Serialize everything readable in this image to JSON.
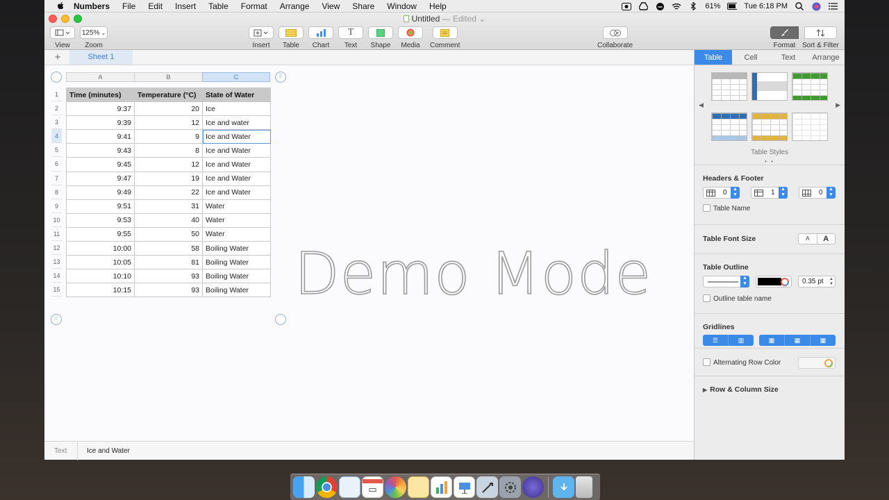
{
  "menubar": {
    "app_name": "Numbers",
    "items": [
      "File",
      "Edit",
      "Insert",
      "Table",
      "Format",
      "Arrange",
      "View",
      "Share",
      "Window",
      "Help"
    ],
    "battery": "61%",
    "clock": "Tue 6:18 PM"
  },
  "window": {
    "title": "Untitled",
    "title_suffix": "— Edited"
  },
  "toolbar": {
    "view_label": "View",
    "zoom_value": "125%",
    "zoom_label": "Zoom",
    "insert_label": "Insert",
    "table_label": "Table",
    "chart_label": "Chart",
    "text_label": "Text",
    "shape_label": "Shape",
    "media_label": "Media",
    "comment_label": "Comment",
    "collaborate_label": "Collaborate",
    "format_label": "Format",
    "sort_filter_label": "Sort & Filter",
    "text_glyph": "T"
  },
  "sheet": {
    "add_sheet_glyph": "+",
    "active_tab": "Sheet 1"
  },
  "table": {
    "column_letters": [
      "A",
      "B",
      "C"
    ],
    "row_numbers": [
      "1",
      "2",
      "3",
      "4",
      "5",
      "6",
      "7",
      "8",
      "9",
      "10",
      "11",
      "12",
      "13",
      "14",
      "15"
    ],
    "headers": [
      "Time (minutes)",
      "Temperature (°C)",
      "State of Water"
    ],
    "rows": [
      [
        "9:37",
        "20",
        "Ice"
      ],
      [
        "9:39",
        "12",
        "Ice and water"
      ],
      [
        "9:41",
        "9",
        "Ice and Water"
      ],
      [
        "9:43",
        "8",
        "Ice and Water"
      ],
      [
        "9:45",
        "12",
        "Ice and Water"
      ],
      [
        "9:47",
        "19",
        "Ice and Water"
      ],
      [
        "9:49",
        "22",
        "Ice and Water"
      ],
      [
        "9:51",
        "31",
        "Water"
      ],
      [
        "9:53",
        "40",
        "Water"
      ],
      [
        "9:55",
        "50",
        "Water"
      ],
      [
        "10:00",
        "58",
        "Boiling Water"
      ],
      [
        "10:05",
        "81",
        "Boiling Water"
      ],
      [
        "10:10",
        "93",
        "Boiling Water"
      ],
      [
        "10:15",
        "93",
        "Boiling Water"
      ]
    ]
  },
  "watermark": "Demo Mode",
  "statusbar": {
    "label": "Text",
    "value": "Ice and Water"
  },
  "inspector": {
    "tabs": [
      "Table",
      "Cell",
      "Text",
      "Arrange"
    ],
    "active_tab": "Table",
    "table_styles_caption": "Table Styles",
    "page_dots": "• •",
    "headers_footer_title": "Headers & Footer",
    "header_rows": "0",
    "header_columns": "1",
    "footer_rows": "0",
    "table_name_label": "Table Name",
    "font_size_title": "Table Font Size",
    "font_small": "A",
    "font_large": "A",
    "outline_title": "Table Outline",
    "outline_width": "0.35 pt",
    "outline_color": "#000000",
    "outline_table_name_label": "Outline table name",
    "gridlines_title": "Gridlines",
    "alternating_row_label": "Alternating Row Color",
    "row_column_size_label": "Row & Column Size"
  },
  "colors": {
    "accent": "#3b8ae8",
    "header_fill": "#c9c9c9",
    "selection": "#dfe9f6"
  }
}
